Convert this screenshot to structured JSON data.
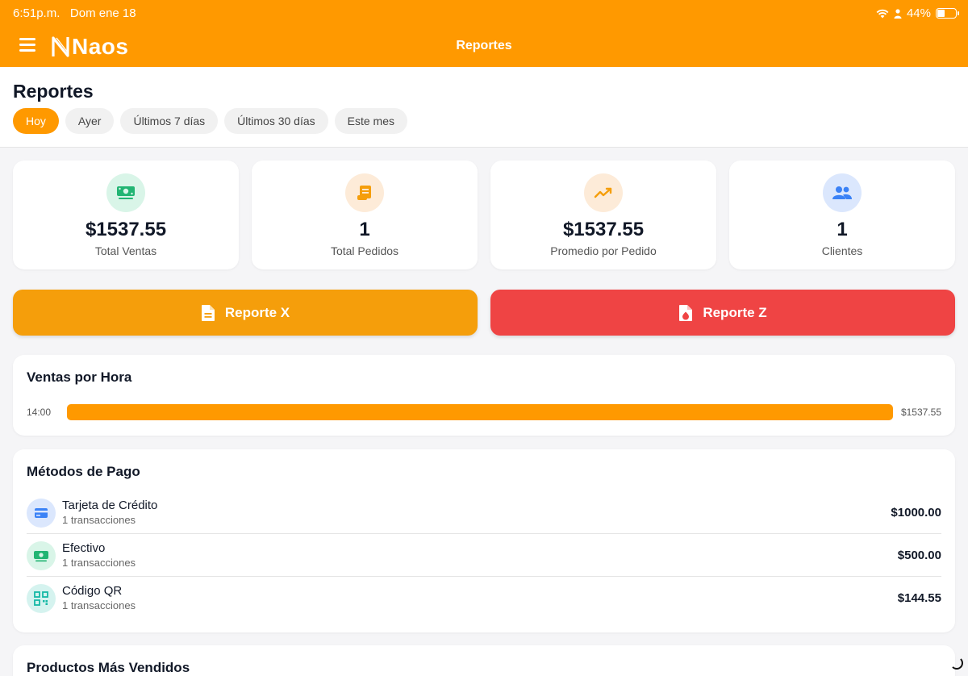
{
  "status_bar": {
    "time": "6:51p.m.",
    "date": "Dom ene 18",
    "battery": "44%",
    "battery_level": 0.44
  },
  "app": {
    "brand": "Naos",
    "title": "Reportes"
  },
  "header": {
    "title": "Reportes",
    "chips": [
      {
        "label": "Hoy",
        "active": true
      },
      {
        "label": "Ayer"
      },
      {
        "label": "Últimos 7 días"
      },
      {
        "label": "Últimos 30 días"
      },
      {
        "label": "Este mes"
      }
    ]
  },
  "stats": [
    {
      "value": "$1537.55",
      "label": "Total Ventas",
      "icon": "money-icon"
    },
    {
      "value": "1",
      "label": "Total Pedidos",
      "icon": "receipt-icon"
    },
    {
      "value": "$1537.55",
      "label": "Promedio por Pedido",
      "icon": "trend-icon"
    },
    {
      "value": "1",
      "label": "Clientes",
      "icon": "users-icon"
    }
  ],
  "reports": {
    "x_label": "Reporte X",
    "z_label": "Reporte Z"
  },
  "hourly": {
    "title": "Ventas por Hora",
    "rows": [
      {
        "hour": "14:00",
        "value": "$1537.55",
        "fraction": 1.0
      }
    ]
  },
  "payments": {
    "title": "Métodos de Pago",
    "methods": [
      {
        "name": "Tarjeta de Crédito",
        "count": "1 transacciones",
        "amount": "$1000.00",
        "icon": "credit-card-icon"
      },
      {
        "name": "Efectivo",
        "count": "1 transacciones",
        "amount": "$500.00",
        "icon": "cash-icon"
      },
      {
        "name": "Código QR",
        "count": "1 transacciones",
        "amount": "$144.55",
        "icon": "qr-code-icon"
      }
    ]
  },
  "products": {
    "title": "Productos Más Vendidos"
  },
  "colors": {
    "primary": "#ff9900",
    "report_x": "#f59e0b",
    "report_z": "#ef4444",
    "green": "#22b573",
    "blue": "#3b82f6",
    "teal": "#14b8a6"
  }
}
